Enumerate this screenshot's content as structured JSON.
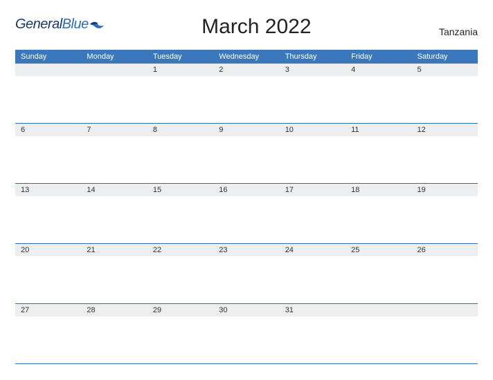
{
  "logo": {
    "word1": "General",
    "word2": "Blue"
  },
  "title": "March 2022",
  "region": "Tanzania",
  "weekdays": [
    "Sunday",
    "Monday",
    "Tuesday",
    "Wednesday",
    "Thursday",
    "Friday",
    "Saturday"
  ],
  "weeks": [
    [
      "",
      "",
      "1",
      "2",
      "3",
      "4",
      "5"
    ],
    [
      "6",
      "7",
      "8",
      "9",
      "10",
      "11",
      "12"
    ],
    [
      "13",
      "14",
      "15",
      "16",
      "17",
      "18",
      "19"
    ],
    [
      "20",
      "21",
      "22",
      "23",
      "24",
      "25",
      "26"
    ],
    [
      "27",
      "28",
      "29",
      "30",
      "31",
      "",
      ""
    ]
  ]
}
